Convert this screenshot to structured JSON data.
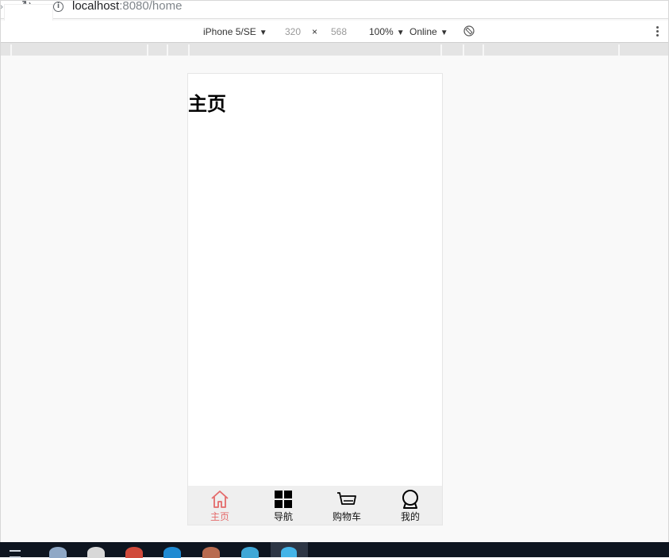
{
  "browser": {
    "url_host": "localhost",
    "url_rest": ":8080/home"
  },
  "device_toolbar": {
    "device": "iPhone 5/SE",
    "width": "320",
    "times": "×",
    "height": "568",
    "zoom": "100%",
    "network": "Online"
  },
  "page": {
    "heading": "主页"
  },
  "tabbar": {
    "tabs": [
      {
        "label": "主页",
        "icon": "home-icon",
        "active": true
      },
      {
        "label": "导航",
        "icon": "grid-icon",
        "active": false
      },
      {
        "label": "购物车",
        "icon": "cart-icon",
        "active": false
      },
      {
        "label": "我的",
        "icon": "user-icon",
        "active": false
      }
    ]
  },
  "colors": {
    "active_tab": "#e46b6b",
    "tabbar_bg": "#efefef",
    "taskbar_bg": "#0e1520"
  }
}
